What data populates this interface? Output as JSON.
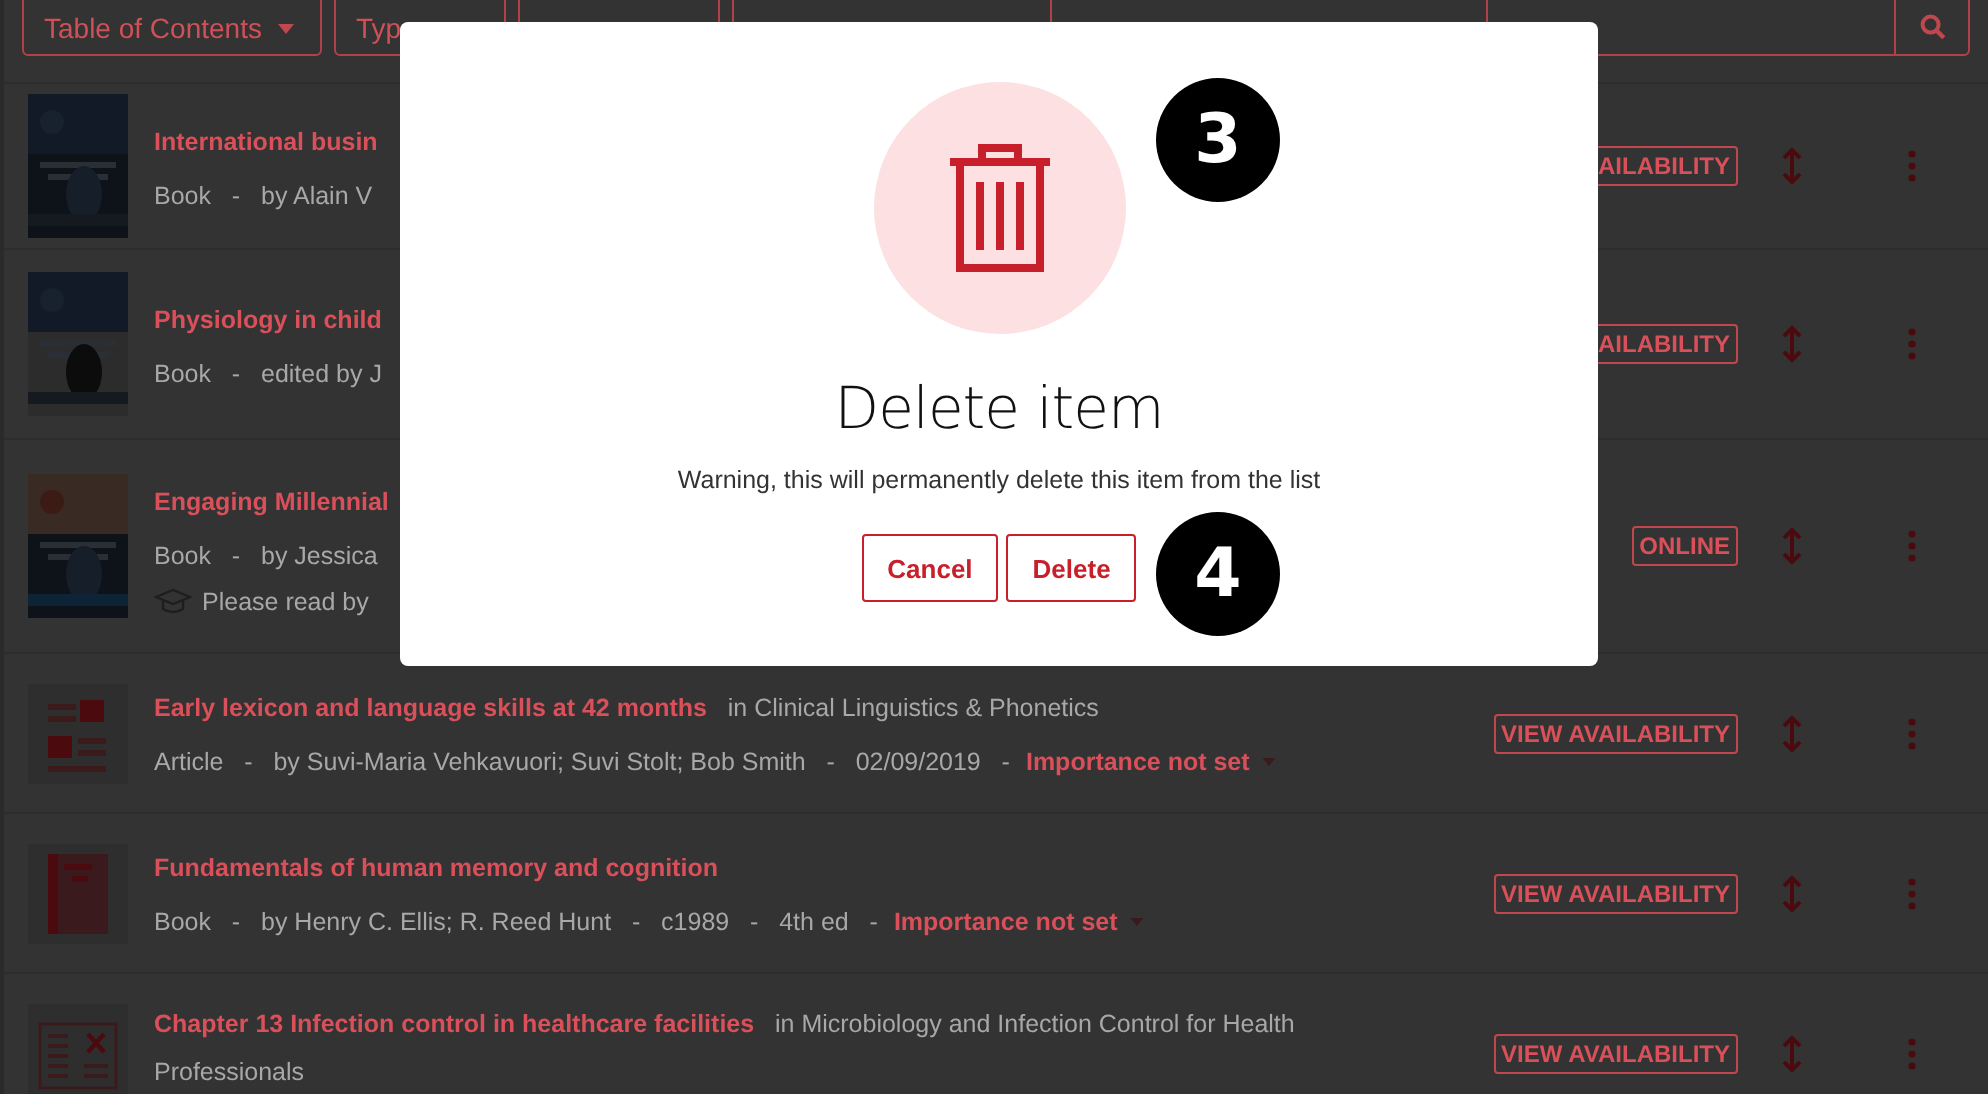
{
  "toolbar": {
    "buttons": [
      {
        "label": "Table of Contents"
      },
      {
        "label": "Typ"
      }
    ]
  },
  "items": [
    {
      "kind": "cover",
      "title": "International busin",
      "meta": "Book   -   by Alain V",
      "action": "AILABILITY"
    },
    {
      "kind": "cover",
      "title": "Physiology in child",
      "meta": "Book   -   edited by J",
      "action": "AILABILITY"
    },
    {
      "kind": "cover",
      "title": "Engaging Millennial",
      "meta": "Book   -   by Jessica",
      "note": "Please read by",
      "action": "ONLINE"
    },
    {
      "kind": "article",
      "title": "Early lexicon and language skills at 42 months",
      "source": "in Clinical Linguistics & Phonetics",
      "meta": "Article   -   by Suvi-Maria Vehkavuori; Suvi Stolt; Bob Smith   -   02/09/2019   -",
      "importance": "Importance not set",
      "action": "VIEW AVAILABILITY"
    },
    {
      "kind": "book",
      "title": "Fundamentals of human memory and cognition",
      "meta": "Book   -   by Henry C. Ellis; R. Reed Hunt   -   c1989   -   4th ed   -",
      "importance": "Importance not set",
      "action": "VIEW AVAILABILITY"
    },
    {
      "kind": "chapter",
      "title": "Chapter 13 Infection control in healthcare facilities",
      "source": "in Microbiology and Infection Control for Health Professionals",
      "action": "VIEW AVAILABILITY"
    }
  ],
  "dialog": {
    "title": "Delete item",
    "message": "Warning, this will permanently delete this item from the list",
    "buttons": [
      {
        "label": "Cancel"
      },
      {
        "label": "Delete"
      }
    ],
    "callouts": [
      "3",
      "4"
    ]
  }
}
